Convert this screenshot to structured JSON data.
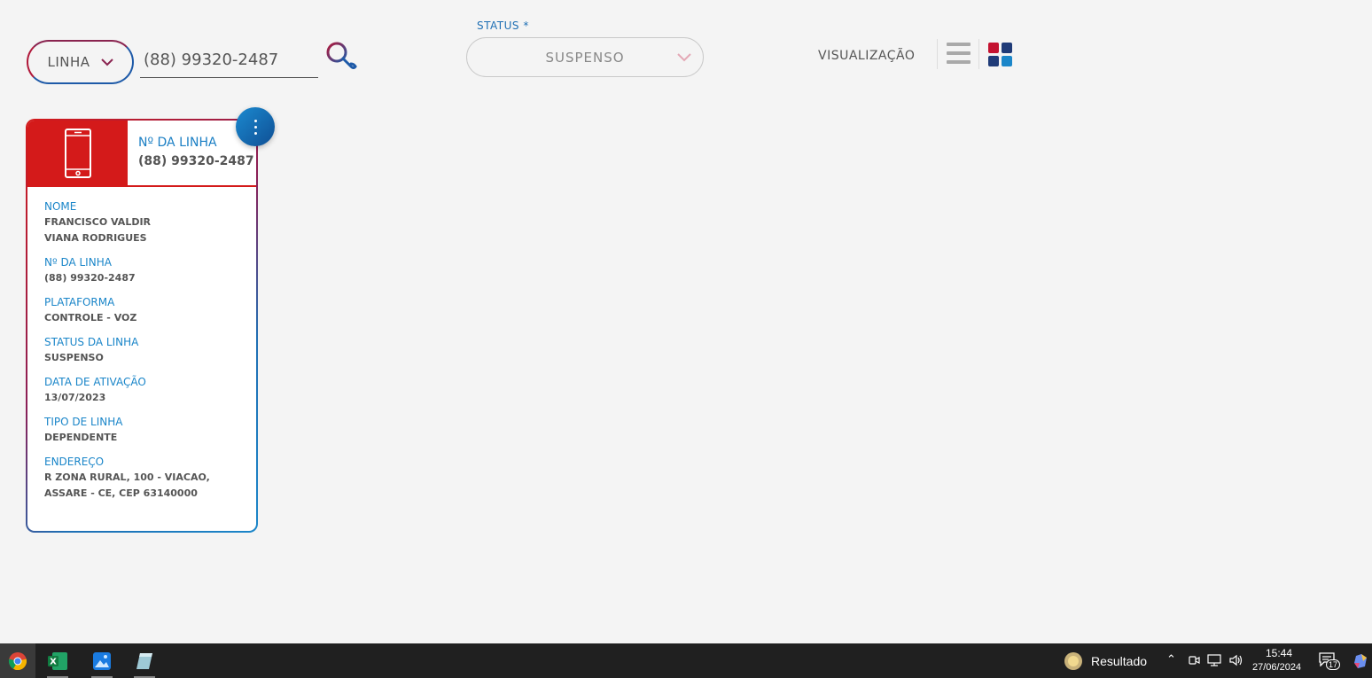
{
  "toolbar": {
    "type_select_label": "LINHA",
    "search_value": "(88) 99320-2487",
    "status_label": "STATUS *",
    "status_value": "SUSPENSO",
    "view_label": "VISUALIZAÇÃO"
  },
  "card": {
    "header_label": "Nº DA LINHA",
    "header_value": "(88) 99320-2487",
    "fields": [
      {
        "label": "NOME",
        "value": "FRANCISCO VALDIR VIANA RODRIGUES"
      },
      {
        "label": "Nº DA LINHA",
        "value": "(88) 99320-2487"
      },
      {
        "label": "PLATAFORMA",
        "value": "CONTROLE - VOZ"
      },
      {
        "label": "STATUS DA LINHA",
        "value": "SUSPENSO"
      },
      {
        "label": "DATA DE ATIVAÇÃO",
        "value": "13/07/2023"
      },
      {
        "label": "TIPO DE LINHA",
        "value": "DEPENDENTE"
      },
      {
        "label": "ENDEREÇO",
        "value": "R ZONA RURAL, 100 - VIACAO, ASSARE - CE, CEP 63140000"
      }
    ]
  },
  "taskbar": {
    "apps": [
      "chrome-icon",
      "excel-icon",
      "photos-icon",
      "notes-icon"
    ],
    "notification_text": "Resultado",
    "time": "15:44",
    "date": "27/06/2024",
    "notification_count": "17"
  },
  "colors": {
    "brand_red": "#d41a1a",
    "brand_blue": "#1b86c9",
    "dark_blue": "#0f4f94",
    "background": "#f4f4f4"
  }
}
